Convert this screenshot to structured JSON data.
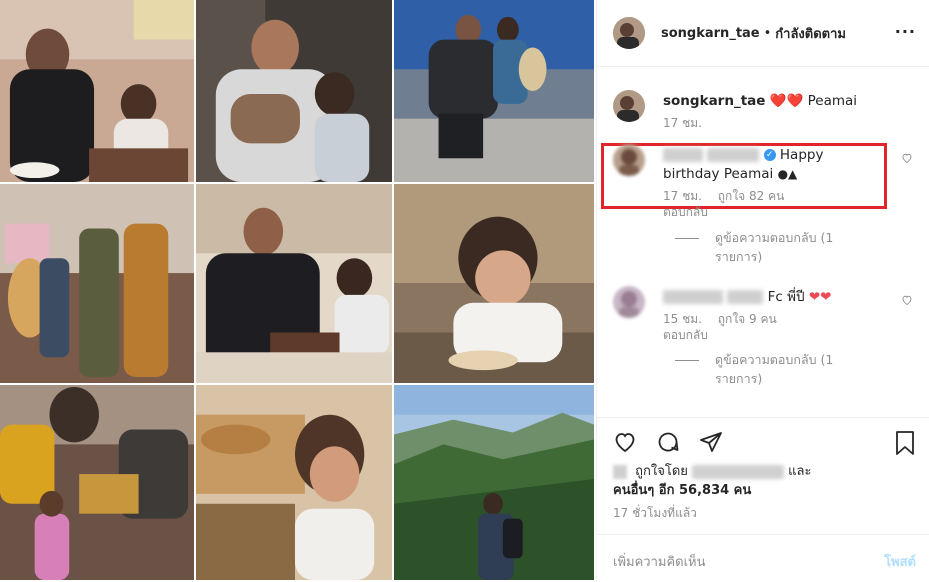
{
  "header": {
    "username": "songkarn_tae",
    "separator": "•",
    "following_label": "กำลังติดตาม",
    "more_label": "···"
  },
  "comments": [
    {
      "username": "songkarn_tae",
      "text": "Peamai",
      "hearts": "❤️❤️",
      "time": "17 ชม."
    },
    {
      "username_hidden": true,
      "text_line1": "Happy",
      "text_line2": "birthday Peamai",
      "time": "17 ชม.",
      "likes": "ถูกใจ 82 คน",
      "reply_label": "ตอบกลับ",
      "view_replies_line1": "ดูข้อความตอบกลับ (1",
      "view_replies_line2": "รายการ)"
    },
    {
      "username_hidden": true,
      "text": "Fc พี่ปี",
      "time": "15 ชม.",
      "likes": "ถูกใจ 9 คน",
      "reply_label": "ตอบกลับ",
      "view_replies_line1": "ดูข้อความตอบกลับ (1",
      "view_replies_line2": "รายการ)"
    }
  ],
  "actions": {
    "liked_by_prefix": "ถูกใจโดย",
    "liked_by_and": "และ",
    "liked_others": "คนอื่นๆ อีก 56,834 คน",
    "time_ago": "17 ชั่วโมงที่แล้ว",
    "comment_placeholder": "เพิ่มความคิดเห็น",
    "post_label": "โพสต์"
  },
  "colors": {
    "highlight_box": "#e0262b",
    "heart_red": "#ed4956",
    "verified_blue": "#3897f0",
    "muted_text": "#8e8e8e",
    "post_disabled": "#b2dffc"
  }
}
